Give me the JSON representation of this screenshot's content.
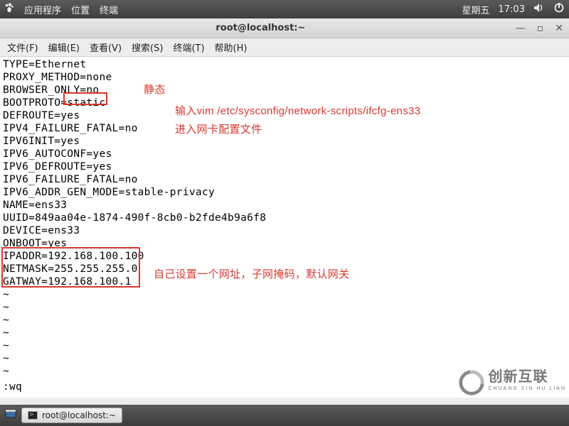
{
  "topbar": {
    "apps": "应用程序",
    "places": "位置",
    "terminal": "终端",
    "day": "星期五",
    "time": "17:03"
  },
  "window": {
    "title": "root@localhost:~"
  },
  "menubar": {
    "file": "文件(F)",
    "edit": "编辑(E)",
    "view": "查看(V)",
    "search": "搜索(S)",
    "terminal": "终端(T)",
    "help": "帮助(H)"
  },
  "config": {
    "l0": "TYPE=Ethernet",
    "l1": "PROXY_METHOD=none",
    "l2": "BROWSER_ONLY=no",
    "l3": "BOOTPROTO=static",
    "l4": "DEFROUTE=yes",
    "l5": "IPV4_FAILURE_FATAL=no",
    "l6": "IPV6INIT=yes",
    "l7": "IPV6_AUTOCONF=yes",
    "l8": "IPV6_DEFROUTE=yes",
    "l9": "IPV6_FAILURE_FATAL=no",
    "l10": "IPV6_ADDR_GEN_MODE=stable-privacy",
    "l11": "NAME=ens33",
    "l12": "UUID=849aa04e-1874-490f-8cb0-b2fde4b9a6f8",
    "l13": "DEVICE=ens33",
    "l14": "ONBOOT=yes",
    "l15": "IPADDR=192.168.100.100",
    "l16": "NETMASK=255.255.255.0",
    "l17": "GATWAY=192.168.100.1"
  },
  "tilde": "~",
  "vim_cmd": ":wq",
  "annotations": {
    "a1": "静态",
    "a2": "输入vim /etc/sysconfig/network-scripts/ifcfg-ens33",
    "a2b": "进入网卡配置文件",
    "a3": "自己设置一个网址，子网掩码，默认网关"
  },
  "taskbar": {
    "item1": "root@localhost:~"
  },
  "watermark": {
    "brand": "创新互联",
    "sub": "CHUANG XIN HU LIAN"
  }
}
